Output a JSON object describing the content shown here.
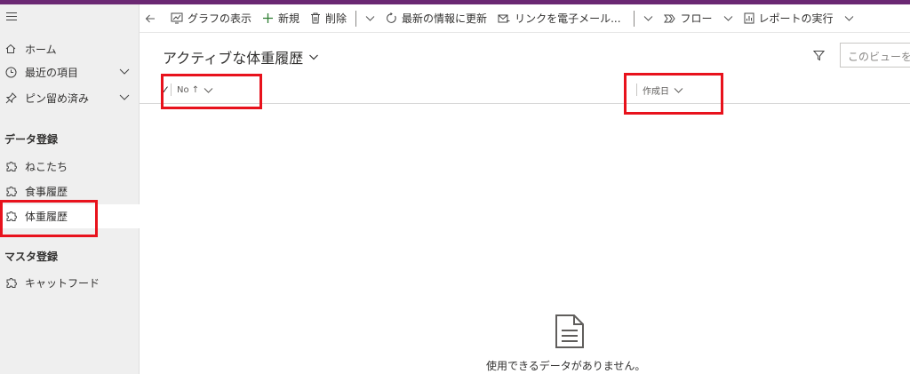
{
  "nav": {
    "items": [
      {
        "label": "ホーム",
        "icon": "home-icon"
      },
      {
        "label": "最近の項目",
        "icon": "clock-icon"
      },
      {
        "label": "ピン留め済み",
        "icon": "pin-icon"
      }
    ],
    "groups": [
      {
        "title": "データ登録",
        "items": [
          {
            "label": "ねこたち",
            "icon": "puzzle-icon"
          },
          {
            "label": "食事履歴",
            "icon": "puzzle-icon"
          },
          {
            "label": "体重履歴",
            "icon": "puzzle-icon",
            "selected": true
          }
        ]
      },
      {
        "title": "マスタ登録",
        "items": [
          {
            "label": "キャットフード",
            "icon": "puzzle-icon"
          }
        ]
      }
    ]
  },
  "toolbar": {
    "show_chart": "グラフの表示",
    "new": "新規",
    "delete": "削除",
    "refresh": "最新の情報に更新",
    "email_link": "リンクを電子メール...",
    "flow": "フロー",
    "run_report": "レポートの実行"
  },
  "view": {
    "title": "アクティブな体重履歴",
    "search_placeholder": "このビューを検索"
  },
  "grid": {
    "columns": [
      {
        "label": "No ↑"
      },
      {
        "label": "作成日"
      }
    ],
    "empty_message": "使用できるデータがありません。"
  },
  "colors": {
    "accent": "#6b2873",
    "highlight": "#e8121c",
    "sidebar_bg": "#efefef"
  }
}
